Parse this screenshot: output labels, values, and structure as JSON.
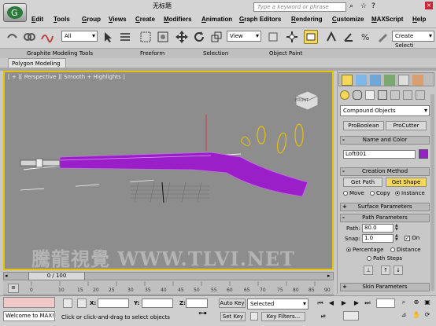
{
  "titlebar": {
    "title": "无标题",
    "search_placeholder": "Type a keyword or phrase"
  },
  "menu": {
    "items": [
      "Edit",
      "Tools",
      "Group",
      "Views",
      "Create",
      "Modifiers",
      "Animation",
      "Graph Editors",
      "Rendering",
      "Customize",
      "MAXScript",
      "Help"
    ]
  },
  "toolbar": {
    "selection_filter": "All",
    "ref_coord": "View",
    "named_selection": "Create Selecti"
  },
  "ribbon": {
    "tabs": [
      "Graphite Modeling Tools",
      "Freeform",
      "Selection",
      "Object Paint"
    ],
    "sub_tab": "Polygon Modeling"
  },
  "viewport": {
    "label": "[ + ][ Perspective ][ Smooth + Highlights ]",
    "viewcube_label": "FRONT",
    "object_color": "#9a1fc8",
    "border_color": "#e8c200",
    "watermark": "騰龍視覺 WWW.TLVI.NET"
  },
  "command_panel": {
    "category": "Compound Objects",
    "object_type_buttons": [
      "ProBoolean",
      "ProCutter"
    ],
    "name_and_color_header": "Name and Color",
    "object_name": "Loft001",
    "object_color": "#9a1fc8",
    "creation_method_header": "Creation Method",
    "get_path_label": "Get Path",
    "get_shape_label": "Get Shape",
    "creation_options": [
      "Move",
      "Copy",
      "Instance"
    ],
    "creation_selected": "Instance",
    "surface_parameters_header": "Surface Parameters",
    "path_parameters_header": "Path Parameters",
    "path_label": "Path:",
    "path_value": "80.0",
    "snap_label": "Snap:",
    "snap_value": "1.0",
    "on_label": "On",
    "on_checked": true,
    "path_mode_options": [
      "Percentage",
      "Distance",
      "Path Steps"
    ],
    "path_mode_selected": "Percentage",
    "skin_parameters_header": "Skin Parameters"
  },
  "timeline": {
    "frame_display": "0 / 100",
    "ticks": [
      "0",
      "10",
      "15",
      "20",
      "25",
      "30",
      "35",
      "40",
      "45",
      "50",
      "55",
      "60",
      "65",
      "70",
      "75",
      "80",
      "85",
      "90"
    ]
  },
  "status": {
    "welcome": "Welcome to MAX!",
    "prompt": "Click or click-and-drag to select objects",
    "x_label": "X:",
    "y_label": "Y:",
    "z_label": "Z:",
    "auto_key": "Auto Key",
    "set_key": "Set Key",
    "key_mode": "Selected",
    "key_filters": "Key Filters...",
    "auto_key_color": "#e8c200"
  }
}
